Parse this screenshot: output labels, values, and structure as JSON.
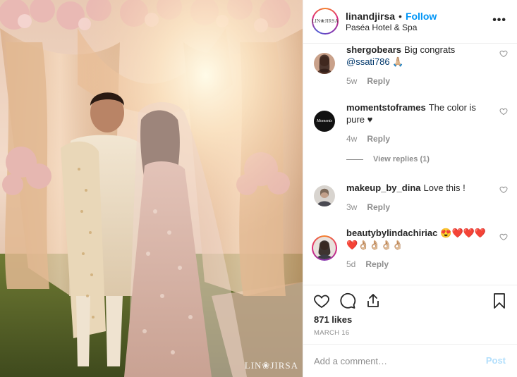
{
  "post": {
    "username": "linandjirsa",
    "separator": "•",
    "follow_label": "Follow",
    "location": "Paséa Hotel & Spa",
    "more_label": "•••",
    "avatar_logo_text": "LIN❀JIRSA",
    "photo_watermark": "LIN❀JIRSA"
  },
  "comments": [
    {
      "username": "shergobears",
      "text_before": "Big congrats",
      "mention": "@ssati786",
      "text_after": " 🙏🏼",
      "age": "5w",
      "reply_label": "Reply"
    },
    {
      "username": "momentstoframes",
      "text": "The color is pure ♥",
      "age": "4w",
      "reply_label": "Reply",
      "avatar_text": "Moments"
    },
    {
      "username": "makeup_by_dina",
      "text": "Love this !",
      "age": "3w",
      "reply_label": "Reply"
    },
    {
      "username": "beautybylindachiriac",
      "text": "😍❤️❤️❤️ ❤️👌🏼👌🏼👌🏼👌🏼",
      "age": "5d",
      "reply_label": "Reply"
    }
  ],
  "view_replies_label": "View replies (1)",
  "likes_text": "871 likes",
  "date_text": "MARCH 16",
  "add_comment": {
    "placeholder": "Add a comment…",
    "post_label": "Post"
  },
  "colors": {
    "accent": "#0095f6",
    "muted": "#8e8e8e",
    "text": "#262626",
    "post_disabled": "#b2dffc"
  },
  "icons": [
    "like-heart-icon",
    "comment-icon",
    "share-icon",
    "bookmark-icon",
    "comment-like-icon"
  ]
}
